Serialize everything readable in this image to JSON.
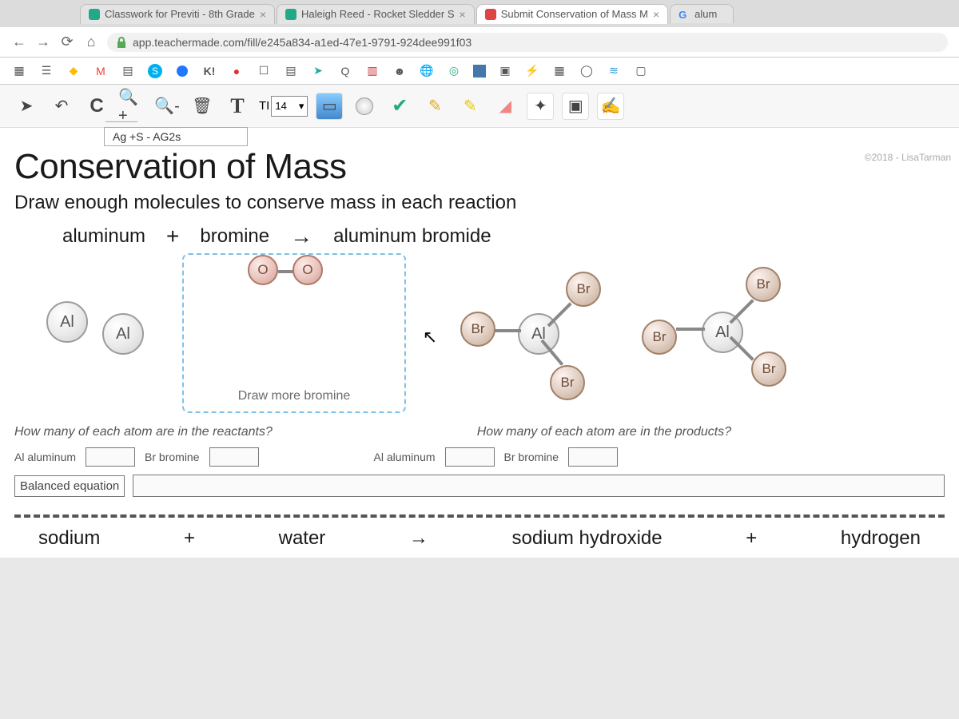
{
  "browser": {
    "tabs": [
      {
        "label": "Classwork for Previti - 8th Grade"
      },
      {
        "label": "Haleigh Reed - Rocket Sledder S"
      },
      {
        "label": "Submit Conservation of Mass M"
      },
      {
        "label": "alum"
      }
    ],
    "url": "app.teachermade.com/fill/e245a834-a1ed-47e1-9791-924dee991f03"
  },
  "toolbar": {
    "font_label": "TI",
    "font_size": "14",
    "caret": "▾"
  },
  "bookmarks": {
    "kahoot": "K!"
  },
  "doc": {
    "name": "Ag +S - AG2s",
    "watermark": "©2018 - LisaTarman"
  },
  "sheet": {
    "title": "Conservation of Mass",
    "instruction": "Draw enough molecules to conserve mass in each reaction",
    "eq1": {
      "r1": "aluminum",
      "plus": "+",
      "r2": "bromine",
      "arrow": "→",
      "p": "aluminum bromide"
    },
    "atoms": {
      "Al": "Al",
      "Br": "Br",
      "O": "O"
    },
    "draw_more": "Draw more bromine",
    "q_reactants": "How many of each atom are in the reactants?",
    "q_products": "How many of each atom are in the products?",
    "lbl_al_1": "Al  aluminum",
    "lbl_br_1": "Br  bromine",
    "lbl_al_2": "Al  aluminum",
    "lbl_br_2": "Br  bromine",
    "balanced": "Balanced equation",
    "eq2": {
      "r1": "sodium",
      "plus1": "+",
      "r2": "water",
      "arrow": "→",
      "p1": "sodium hydroxide",
      "plus2": "+",
      "p2": "hydrogen"
    }
  }
}
